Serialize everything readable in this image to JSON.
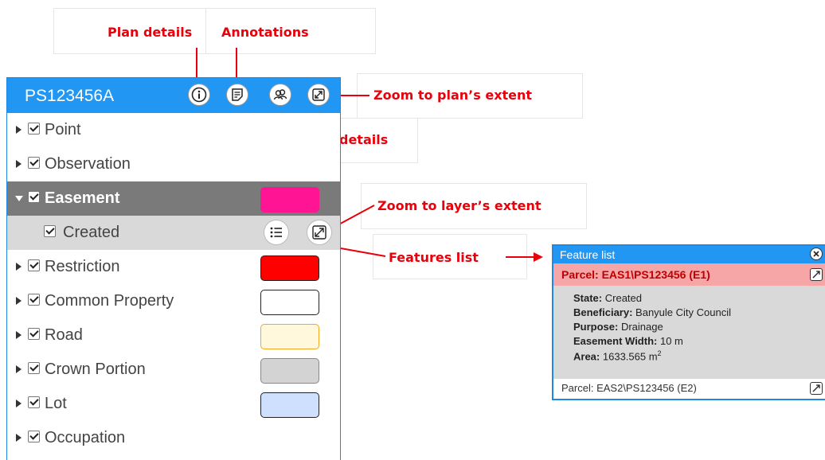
{
  "callouts": {
    "plan_details": "Plan details",
    "annotations": "Annotations",
    "zoom_plan": "Zoom to plan’s extent",
    "parties": "details",
    "zoom_layer": "Zoom to layer’s extent",
    "features_list": "Features list"
  },
  "panel": {
    "title": "PS123456A",
    "layers": [
      {
        "label": "Point"
      },
      {
        "label": "Observation"
      },
      {
        "label": "Easement",
        "fill": "#ff1493",
        "stroke": "#ff1493"
      },
      {
        "label": "Created"
      },
      {
        "label": "Restriction",
        "fill": "#ff0000",
        "stroke": "#222222"
      },
      {
        "label": "Common Property",
        "fill": "#ffffff",
        "stroke": "#222222"
      },
      {
        "label": "Road",
        "fill": "#fff8dc",
        "stroke": "#f5a623"
      },
      {
        "label": "Crown Portion",
        "fill": "#d3d3d3",
        "stroke": "#888888"
      },
      {
        "label": "Lot",
        "fill": "#cfe0ff",
        "stroke": "#222222"
      },
      {
        "label": "Occupation"
      }
    ]
  },
  "feature_list": {
    "title": "Feature list",
    "selected": {
      "title": "Parcel: EAS1\\PS123456 (E1)",
      "attributes": [
        {
          "key": "State:",
          "value": "Created"
        },
        {
          "key": "Beneficiary:",
          "value": "Banyule City Council"
        },
        {
          "key": "Purpose:",
          "value": "Drainage"
        },
        {
          "key": "Easement Width:",
          "value": "10 m"
        },
        {
          "key": "Area:",
          "value": "1633.565 m",
          "sup": "2"
        }
      ]
    },
    "other": "Parcel: EAS2\\PS123456 (E2)"
  },
  "colors": {
    "accent": "#2196f3",
    "callout": "#e8000b",
    "selected_row": "#f6a6a6"
  }
}
